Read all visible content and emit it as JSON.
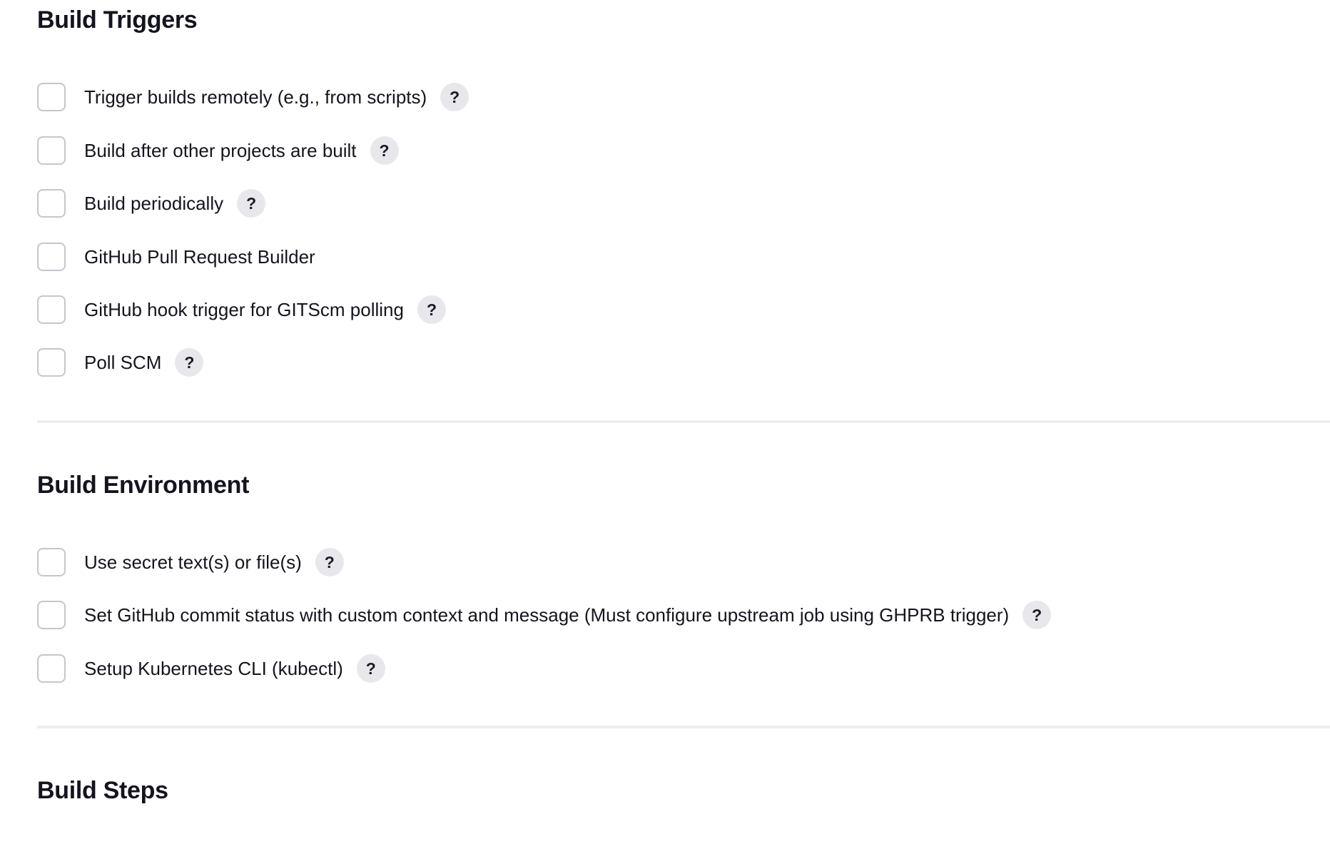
{
  "build_triggers": {
    "title": "Build Triggers",
    "items": [
      {
        "label": "Trigger builds remotely (e.g., from scripts)",
        "checked": false,
        "help": "?"
      },
      {
        "label": "Build after other projects are built",
        "checked": false,
        "help": "?"
      },
      {
        "label": "Build periodically",
        "checked": false,
        "help": "?"
      },
      {
        "label": "GitHub Pull Request Builder",
        "checked": false
      },
      {
        "label": "GitHub hook trigger for GITScm polling",
        "checked": false,
        "help": "?"
      },
      {
        "label": "Poll SCM",
        "checked": false,
        "help": "?"
      }
    ]
  },
  "build_environment": {
    "title": "Build Environment",
    "items": [
      {
        "label": "Use secret text(s) or file(s)",
        "checked": false,
        "help": "?"
      },
      {
        "label": "Set GitHub commit status with custom context and message (Must configure upstream job using GHPRB trigger)",
        "checked": false,
        "help": "?"
      },
      {
        "label": "Setup Kubernetes CLI (kubectl)",
        "checked": false,
        "help": "?"
      }
    ]
  },
  "build_steps": {
    "title": "Build Steps"
  }
}
